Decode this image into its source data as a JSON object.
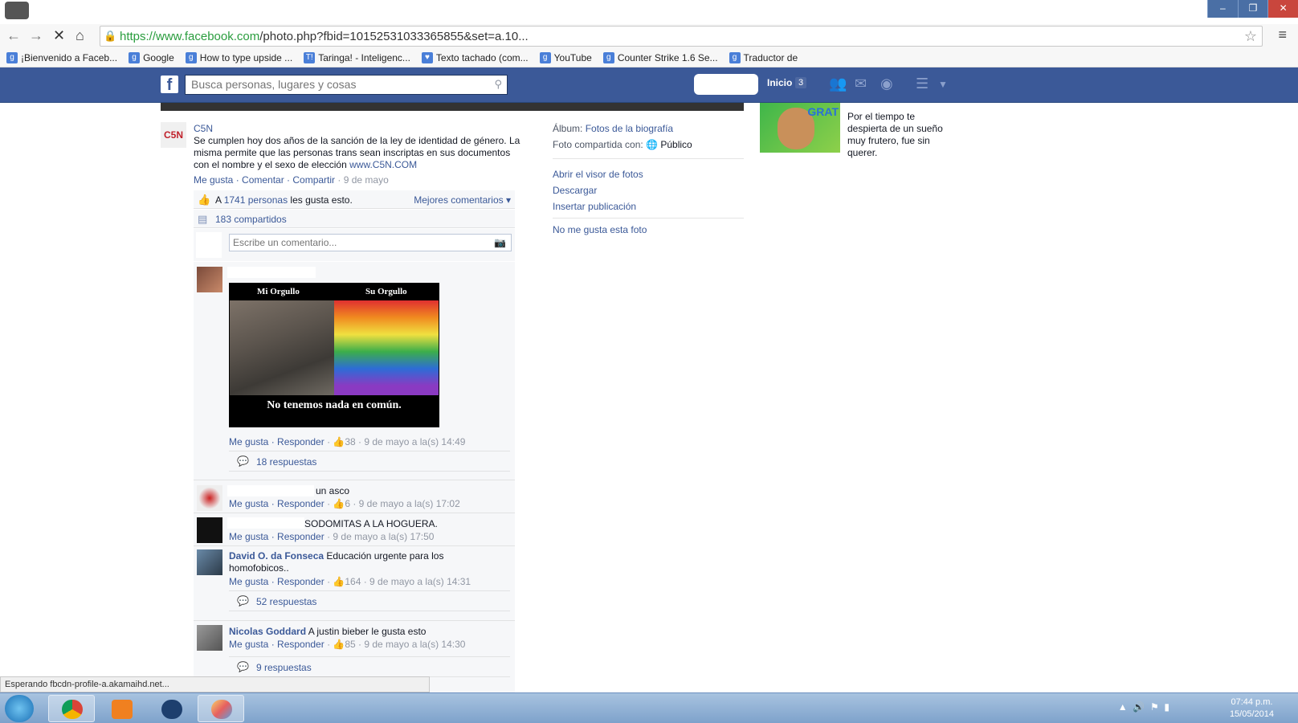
{
  "browser": {
    "window_controls": [
      "–",
      "❐",
      "✕"
    ],
    "url_host": "https://www.facebook.com",
    "url_path": "/photo.php?fbid=10152531033365855&set=a.10...",
    "bookmarks": [
      {
        "label": "¡Bienvenido a Faceb...",
        "icon": "g"
      },
      {
        "label": "Google",
        "icon": "g"
      },
      {
        "label": "How to type upside ...",
        "icon": "g"
      },
      {
        "label": "Taringa! - Inteligenc...",
        "icon": "T!"
      },
      {
        "label": "Texto tachado (com...",
        "icon": "♥"
      },
      {
        "label": "YouTube",
        "icon": "g"
      },
      {
        "label": "Counter Strike 1.6 Se...",
        "icon": "g"
      },
      {
        "label": "Traductor de",
        "icon": "g"
      }
    ],
    "status": "Esperando fbcdn-profile-a.akamaihd.net..."
  },
  "fb": {
    "search_placeholder": "Busca personas, lugares y cosas",
    "inicio": "Inicio",
    "inicio_count": "3"
  },
  "post": {
    "author": "C5N",
    "logo": "C5N",
    "text": "Se cumplen hoy dos años de la sanción de la ley de identidad de género. La misma permite que las personas trans sean inscriptas en sus documentos con el nombre y el sexo de elección ",
    "link": "www.C5N.COM",
    "actions": "Me gusta · Comentar · Compartir",
    "date": " · 9 de mayo",
    "likes_prefix": "A ",
    "likes_link": "1741 personas",
    "likes_suffix": " les gusta esto.",
    "best": "Mejores comentarios ▾",
    "shares": "183 compartidos",
    "comment_placeholder": "Escribe un comentario..."
  },
  "meme": {
    "left_title": "Mi Orgullo",
    "right_title": "Su Orgullo",
    "bottom": "No tenemos nada en común."
  },
  "comments": [
    {
      "meta_links": "Me gusta · Responder",
      "meta": " · 👍38 · 9 de mayo a la(s) 14:49",
      "replies": "18 respuestas"
    },
    {
      "text": "un asco",
      "meta_links": "Me gusta · Responder",
      "meta": " · 👍6 · 9 de mayo a la(s) 17:02"
    },
    {
      "text": "SODOMITAS A LA HOGUERA.",
      "meta_links": "Me gusta · Responder",
      "meta": " · 9 de mayo a la(s) 17:50"
    },
    {
      "name": "David O. da Fonseca",
      "text": " Educación urgente para los homofobicos..",
      "meta_links": "Me gusta · Responder",
      "meta": " · 👍164 · 9 de mayo a la(s) 14:31",
      "replies": "52 respuestas"
    },
    {
      "name": "Nicolas Goddard",
      "text": " A justin bieber le gusta esto",
      "meta_links": "Me gusta · Responder",
      "meta": " · 👍85 · 9 de mayo a la(s) 14:30",
      "replies": "9 respuestas"
    }
  ],
  "right": {
    "album_label": "Álbum: ",
    "album_value": "Fotos de la biografía",
    "shared_label": "Foto compartida con: ",
    "shared_value": "Público",
    "open_viewer": "Abrir el visor de fotos",
    "download": "Descargar",
    "embed": "Insertar publicación",
    "dislike": "No me gusta esta foto"
  },
  "ad": {
    "badge": "GRAT",
    "text": "Por el tiempo te despierta de un sueño muy frutero, fue sin querer."
  },
  "taskbar": {
    "time": "07:44 p.m.",
    "date": "15/05/2014"
  }
}
